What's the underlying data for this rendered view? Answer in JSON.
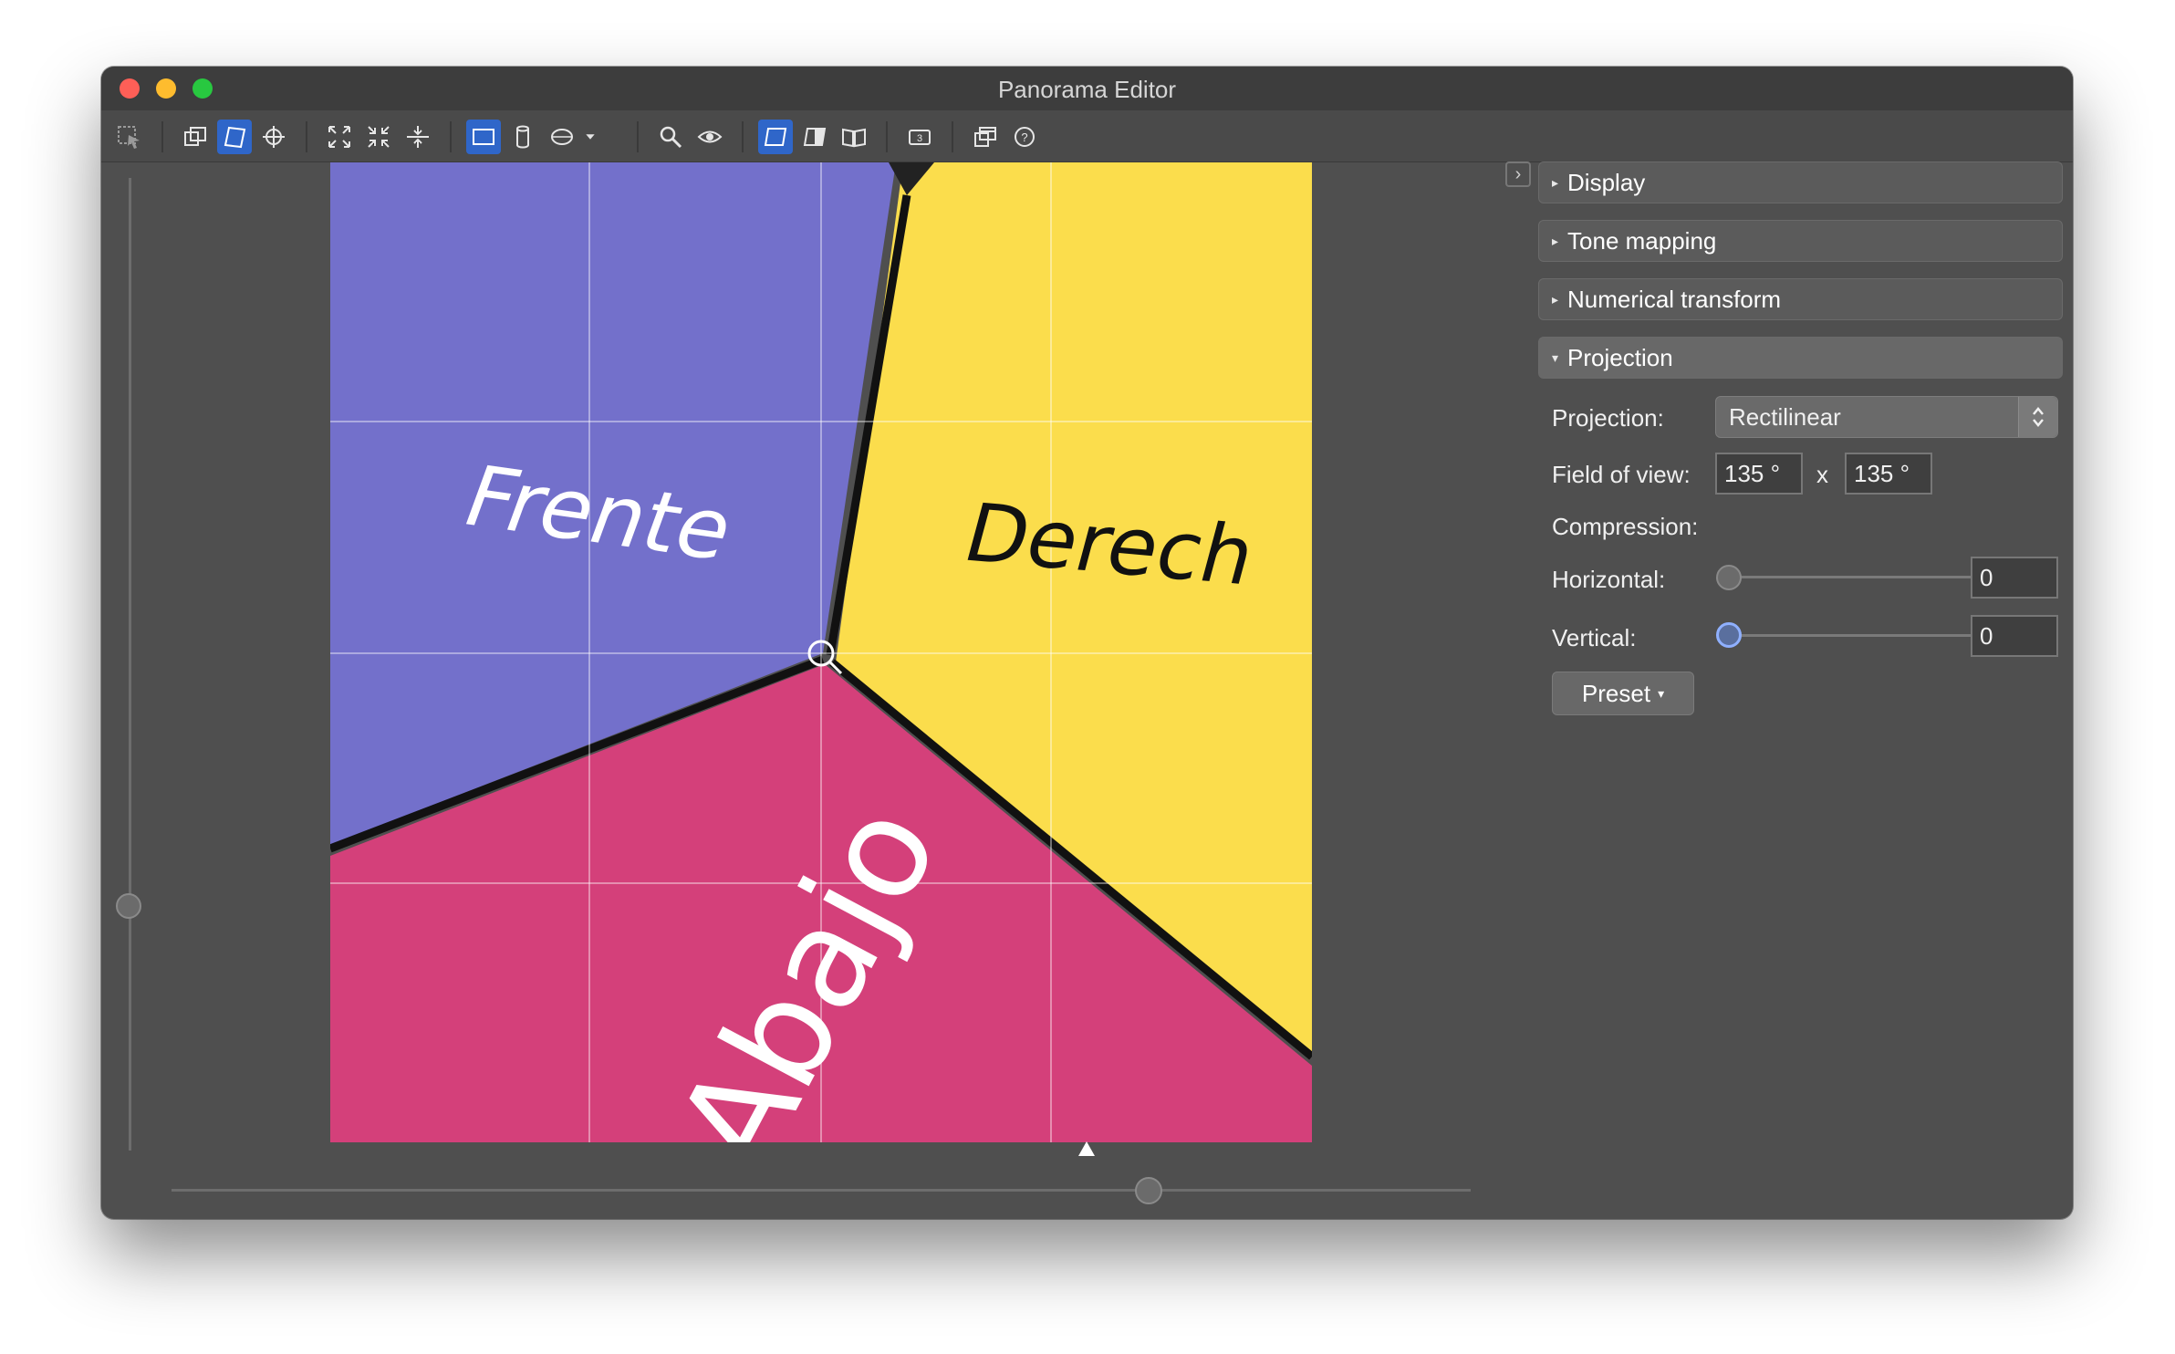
{
  "window": {
    "title": "Panorama Editor"
  },
  "toolbar": {
    "icons": [
      "select-icon",
      "preview-icon",
      "layout-icon",
      "crosshair-icon",
      "fit-icon",
      "center-icon",
      "straighten-icon",
      "rectilinear-icon",
      "cylindrical-icon",
      "equirect-icon",
      "dropdown-icon",
      "zoom-icon",
      "eye-icon",
      "view-flat-icon",
      "view-contrast-icon",
      "view-book-icon",
      "badge-3-icon",
      "window-icon",
      "help-icon"
    ]
  },
  "preview": {
    "labels": {
      "front": "Frente",
      "right": "Derech",
      "bottom": "Abajo"
    },
    "colors": {
      "purple": "#7370cb",
      "yellow": "#fbdd4c",
      "pink": "#d4407a"
    }
  },
  "panel": {
    "toggle": "›",
    "sections": [
      {
        "label": "Display",
        "open": false
      },
      {
        "label": "Tone mapping",
        "open": false
      },
      {
        "label": "Numerical transform",
        "open": false
      },
      {
        "label": "Projection",
        "open": true
      }
    ],
    "projection": {
      "projection_label": "Projection:",
      "projection_value": "Rectilinear",
      "fov_label": "Field of view:",
      "fov_h": "135 °",
      "fov_sep": "x",
      "fov_v": "135 °",
      "compression_label": "Compression:",
      "horizontal_label": "Horizontal:",
      "horizontal_value": "0",
      "vertical_label": "Vertical:",
      "vertical_value": "0",
      "preset_label": "Preset"
    }
  }
}
